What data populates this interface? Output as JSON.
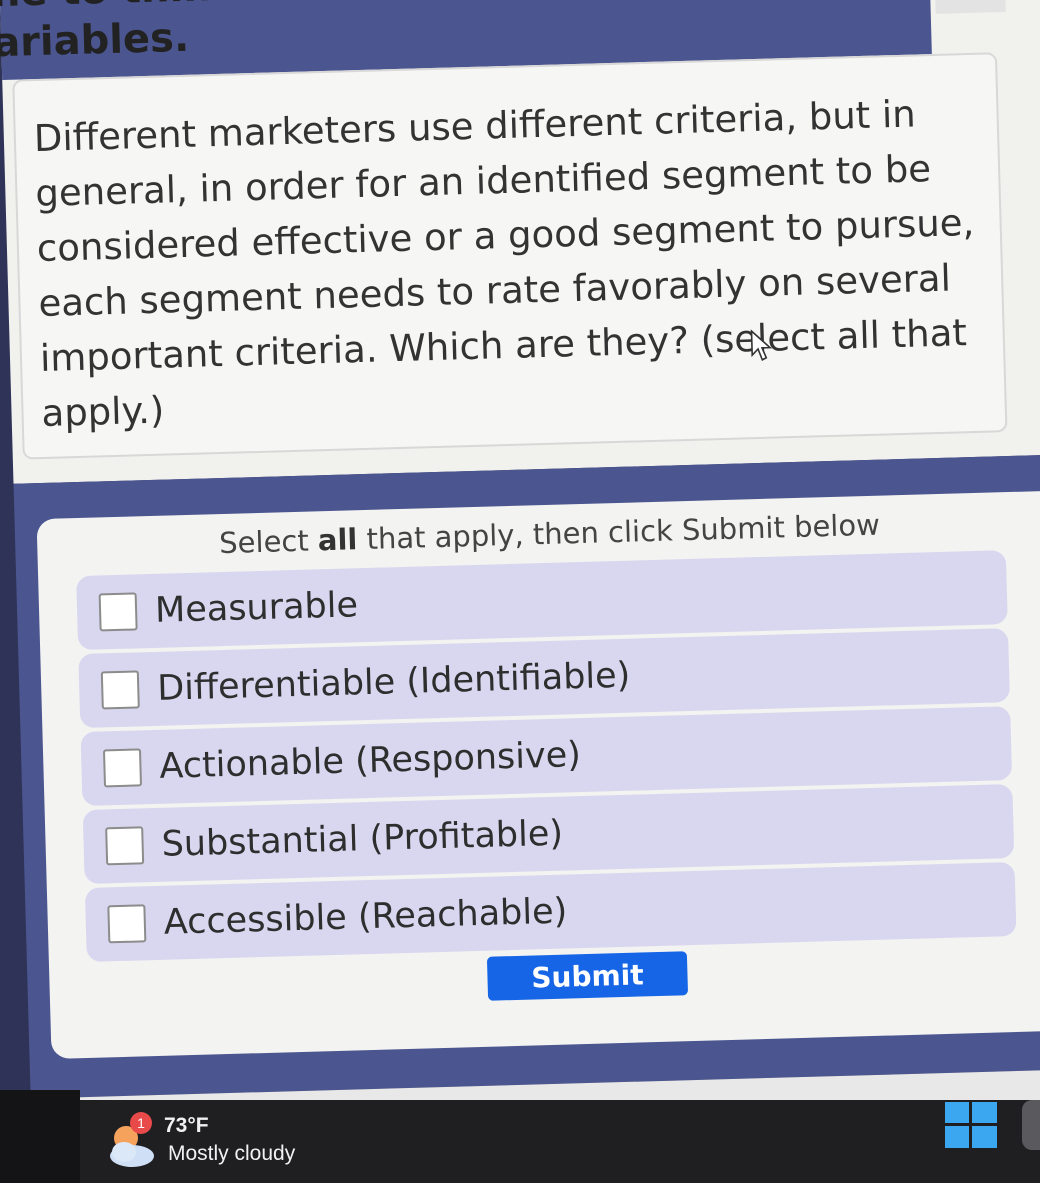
{
  "page": {
    "heading_top_fragment": "ne to think",
    "heading_fragment": "ariables."
  },
  "question": {
    "text": "Different marketers use different criteria, but in general, in order for an identified segment to be considered effective or a good segment to pursue, each segment needs to rate favorably on several important criteria. Which are they? (select all that apply.)"
  },
  "answers": {
    "instruction_prefix": "Select ",
    "instruction_bold": "all",
    "instruction_suffix": " that apply, then click Submit below",
    "options": [
      {
        "label": "Measurable",
        "checked": false
      },
      {
        "label": "Differentiable (Identifiable)",
        "checked": false
      },
      {
        "label": "Actionable (Responsive)",
        "checked": false
      },
      {
        "label": "Substantial (Profitable)",
        "checked": false
      },
      {
        "label": "Accessible (Reachable)",
        "checked": false
      }
    ],
    "submit_label": "Submit"
  },
  "taskbar": {
    "weather_badge": "1",
    "temperature": "73°F",
    "condition": "Mostly cloudy",
    "weather_icon": "partly-cloudy-icon",
    "start_icon": "windows-logo-icon"
  },
  "colors": {
    "band": "#4b558f",
    "option_bg": "#d9d7ef",
    "submit": "#1565e6",
    "taskbar": "#1f1f22"
  }
}
